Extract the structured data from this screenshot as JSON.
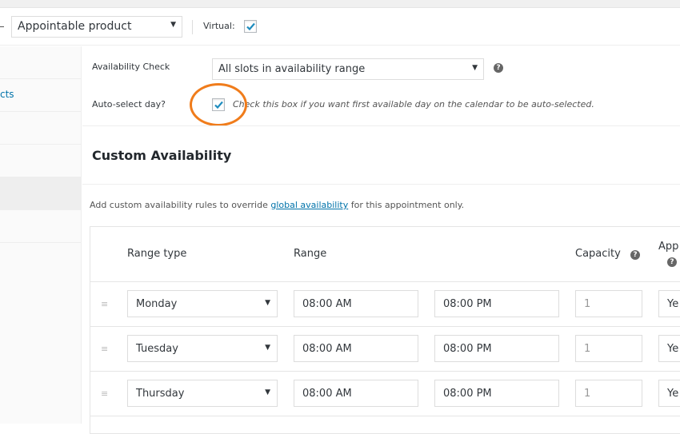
{
  "header": {
    "product_type": "Appointable product",
    "virtual_label": "Virtual:",
    "virtual_checked": true
  },
  "sidebar": {
    "items": [
      {
        "label": ""
      },
      {
        "label": "cts"
      },
      {
        "label": ""
      },
      {
        "label": ""
      },
      {
        "label": "",
        "active": true
      },
      {
        "label": ""
      }
    ]
  },
  "settings": {
    "availability_check_label": "Availability Check",
    "availability_check_value": "All slots in availability range",
    "auto_select_label": "Auto-select day?",
    "auto_select_checked": true,
    "auto_select_description": "Check this box if you want first available day on the calendar to be auto-selected."
  },
  "custom_availability": {
    "title": "Custom Availability",
    "intro_before": "Add custom availability rules to override ",
    "intro_link": "global availability",
    "intro_after": " for this appointment only.",
    "columns": {
      "range_type": "Range type",
      "range": "Range",
      "capacity": "Capacity",
      "appointable": "App"
    },
    "rows": [
      {
        "range_type": "Monday",
        "from": "08:00 AM",
        "to": "08:00 PM",
        "capacity": "1",
        "appointable": "Ye"
      },
      {
        "range_type": "Tuesday",
        "from": "08:00 AM",
        "to": "08:00 PM",
        "capacity": "1",
        "appointable": "Ye"
      },
      {
        "range_type": "Thursday",
        "from": "08:00 AM",
        "to": "08:00 PM",
        "capacity": "1",
        "appointable": "Ye"
      }
    ]
  },
  "icons": {
    "help": "?",
    "dropdown": "▼",
    "drag": "≡"
  },
  "colors": {
    "accent_link": "#0073aa",
    "highlight_ring": "#f07c1b",
    "checkmark": "#1e8cbe"
  }
}
